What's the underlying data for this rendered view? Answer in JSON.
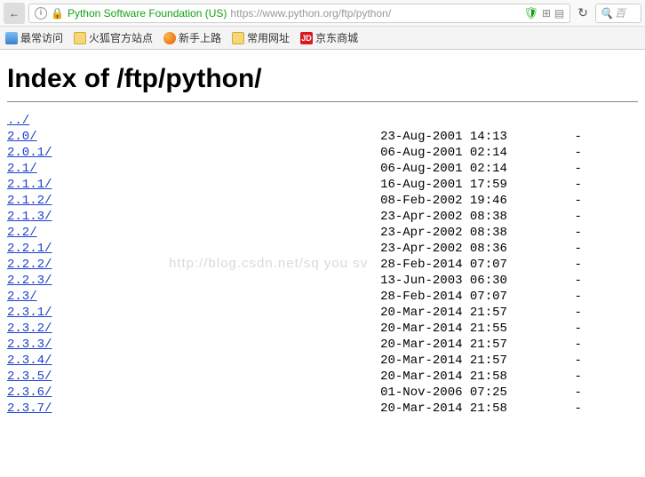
{
  "browser": {
    "identity": "Python Software Foundation (US)",
    "url_display": "https://www.python.org/ftp/python/",
    "search_hint": "百",
    "back_glyph": "←",
    "info_glyph": "i",
    "lock_glyph": "🔒",
    "shield_glyph": "🛡",
    "qr_glyph": "⊞",
    "reader_glyph": "▤",
    "reload_glyph": "↻",
    "search_glyph": "🔍"
  },
  "bookmarks": {
    "most_visited": "最常访问",
    "fx_official": "火狐官方站点",
    "newbie": "新手上路",
    "common_sites": "常用网址",
    "jd": "京东商城",
    "jd_badge": "JD"
  },
  "page": {
    "title": "Index of /ftp/python/",
    "watermark": "http://blog.csdn.net/sq  you sv",
    "parent_link": "../",
    "entries": [
      {
        "name": "2.0/",
        "date": "23-Aug-2001 14:13",
        "size": "-"
      },
      {
        "name": "2.0.1/",
        "date": "06-Aug-2001 02:14",
        "size": "-"
      },
      {
        "name": "2.1/",
        "date": "06-Aug-2001 02:14",
        "size": "-"
      },
      {
        "name": "2.1.1/",
        "date": "16-Aug-2001 17:59",
        "size": "-"
      },
      {
        "name": "2.1.2/",
        "date": "08-Feb-2002 19:46",
        "size": "-"
      },
      {
        "name": "2.1.3/",
        "date": "23-Apr-2002 08:38",
        "size": "-"
      },
      {
        "name": "2.2/",
        "date": "23-Apr-2002 08:38",
        "size": "-"
      },
      {
        "name": "2.2.1/",
        "date": "23-Apr-2002 08:36",
        "size": "-"
      },
      {
        "name": "2.2.2/",
        "date": "28-Feb-2014 07:07",
        "size": "-"
      },
      {
        "name": "2.2.3/",
        "date": "13-Jun-2003 06:30",
        "size": "-"
      },
      {
        "name": "2.3/",
        "date": "28-Feb-2014 07:07",
        "size": "-"
      },
      {
        "name": "2.3.1/",
        "date": "20-Mar-2014 21:57",
        "size": "-"
      },
      {
        "name": "2.3.2/",
        "date": "20-Mar-2014 21:55",
        "size": "-"
      },
      {
        "name": "2.3.3/",
        "date": "20-Mar-2014 21:57",
        "size": "-"
      },
      {
        "name": "2.3.4/",
        "date": "20-Mar-2014 21:57",
        "size": "-"
      },
      {
        "name": "2.3.5/",
        "date": "20-Mar-2014 21:58",
        "size": "-"
      },
      {
        "name": "2.3.6/",
        "date": "01-Nov-2006 07:25",
        "size": "-"
      },
      {
        "name": "2.3.7/",
        "date": "20-Mar-2014 21:58",
        "size": "-"
      }
    ]
  }
}
